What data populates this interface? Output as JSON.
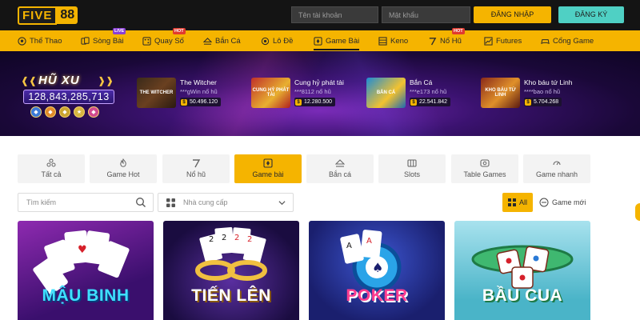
{
  "header": {
    "logo_left": "FIVE",
    "logo_right": "88",
    "username_placeholder": "Tên tài khoản",
    "password_placeholder": "Mật khẩu",
    "login_label": "ĐĂNG NHẬP",
    "register_label": "ĐĂNG KÝ"
  },
  "nav": {
    "items": [
      {
        "label": "Thể Thao",
        "icon": "soccer-ball-icon"
      },
      {
        "label": "Sòng Bài",
        "icon": "cards-icon",
        "badge": "LIVE"
      },
      {
        "label": "Quay Số",
        "icon": "lottery-icon",
        "badge": "HOT"
      },
      {
        "label": "Bắn Cá",
        "icon": "fish-icon"
      },
      {
        "label": "Lô Đề",
        "icon": "number-ball-icon"
      },
      {
        "label": "Game Bài",
        "icon": "card-game-icon",
        "active": true
      },
      {
        "label": "Keno",
        "icon": "keno-icon"
      },
      {
        "label": "Nổ Hũ",
        "icon": "slot-icon",
        "badge": "HOT"
      },
      {
        "label": "Futures",
        "icon": "chart-icon"
      },
      {
        "label": "Cổng Game",
        "icon": "gamepad-icon"
      }
    ]
  },
  "banner": {
    "jackpot_title": "HŨ XU",
    "jackpot_amount": "128,843,285,713",
    "winners": [
      {
        "game": "The Witcher",
        "user": "***gWin nổ hũ",
        "amount": "50.496.120",
        "thumb_text": "THE WITCHER"
      },
      {
        "game": "Cung hỷ phát tài",
        "user": "***8112 nổ hũ",
        "amount": "12.280.500",
        "thumb_text": "CUNG HỶ PHÁT TÀI"
      },
      {
        "game": "Bắn Cá",
        "user": "***e173 nổ hũ",
        "amount": "22.541.842",
        "thumb_text": "BẮN CÁ"
      },
      {
        "game": "Kho báu tứ Linh",
        "user": "****bao nổ hũ",
        "amount": "5.704.268",
        "thumb_text": "KHO BÁU TỨ LINH"
      }
    ]
  },
  "categories": [
    {
      "label": "Tất cả",
      "icon": "all-games-icon"
    },
    {
      "label": "Game Hot",
      "icon": "flame-icon"
    },
    {
      "label": "Nổ hũ",
      "icon": "seven-icon"
    },
    {
      "label": "Game bài",
      "icon": "card-game-icon",
      "active": true
    },
    {
      "label": "Bắn cá",
      "icon": "fishing-icon"
    },
    {
      "label": "Slots",
      "icon": "slot-machine-icon"
    },
    {
      "label": "Table Games",
      "icon": "table-icon"
    },
    {
      "label": "Game nhanh",
      "icon": "speed-icon"
    }
  ],
  "filters": {
    "search_placeholder": "Tìm kiếm",
    "provider_label": "Nhà cung cấp",
    "all_label": "All",
    "new_label": "Game mới"
  },
  "games": [
    {
      "title": "MẬU BINH",
      "colors": {
        "bg1": "#7e1f9e",
        "bg2": "#3a0f6d",
        "text": "#3ee0ff"
      }
    },
    {
      "title": "TIẾN LÊN",
      "colors": {
        "bg1": "#3a1f6e",
        "bg2": "#140a35",
        "text": "#ffffff"
      }
    },
    {
      "title": "POKER",
      "colors": {
        "bg1": "#2f3fb0",
        "bg2": "#181f6e",
        "text": "#ff3d8f"
      }
    },
    {
      "title": "BẦU CUA",
      "colors": {
        "bg1": "#8fd6e6",
        "bg2": "#3aa6bd",
        "text": "#ffffff"
      }
    }
  ],
  "colors": {
    "accent": "#f5b400",
    "header_bg": "#141414",
    "register": "#4fd0c4"
  }
}
